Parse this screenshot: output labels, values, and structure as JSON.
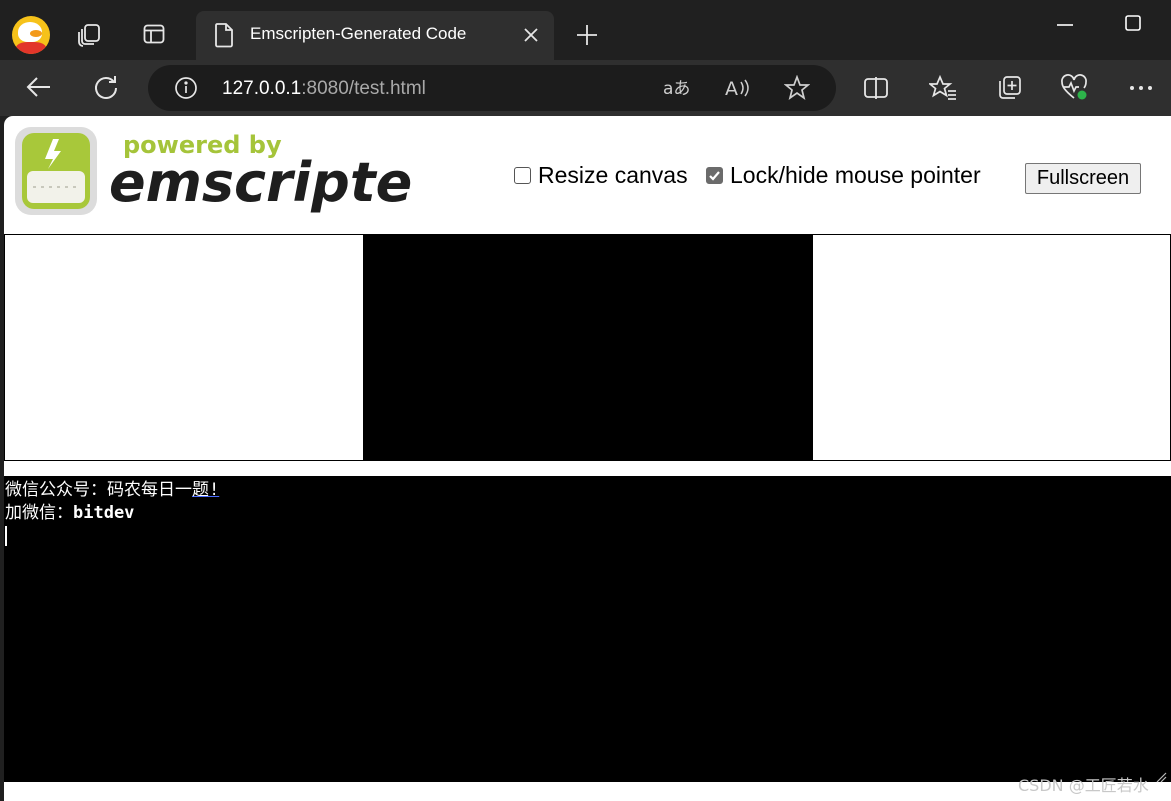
{
  "tab": {
    "title": "Emscripten-Generated Code"
  },
  "address": {
    "host": "127.0.0.1",
    "rest": ":8080/test.html"
  },
  "logo": {
    "tagline": "powered by",
    "wordmark": "emscripten"
  },
  "controls": {
    "resize_label": "Resize canvas",
    "resize_checked": false,
    "lock_label": "Lock/hide mouse pointer",
    "lock_checked": true,
    "fullscreen_label": "Fullscreen"
  },
  "output": {
    "line1_prefix": "微信公众号：码农每日一",
    "line1_link": "题!",
    "line2_prefix": "加微信：",
    "line2_value": "bitdev"
  },
  "watermark": "CSDN @工匠若水",
  "icons": {
    "profile": "profile-avatar-icon",
    "workspaces": "workspaces-icon",
    "tab_actions": "tab-actions-icon",
    "document": "document-icon",
    "close": "close-icon",
    "new_tab": "plus-icon",
    "minimize": "minimize-icon",
    "maximize": "maximize-icon",
    "back": "arrow-left-icon",
    "refresh": "refresh-icon",
    "site_info": "info-icon",
    "translate": "translate-icon",
    "read_aloud": "read-aloud-icon",
    "favorite": "star-icon",
    "split_screen": "split-screen-icon",
    "favorites": "favorites-list-icon",
    "collections": "collections-icon",
    "performance": "heartbeat-icon",
    "menu": "more-icon"
  }
}
